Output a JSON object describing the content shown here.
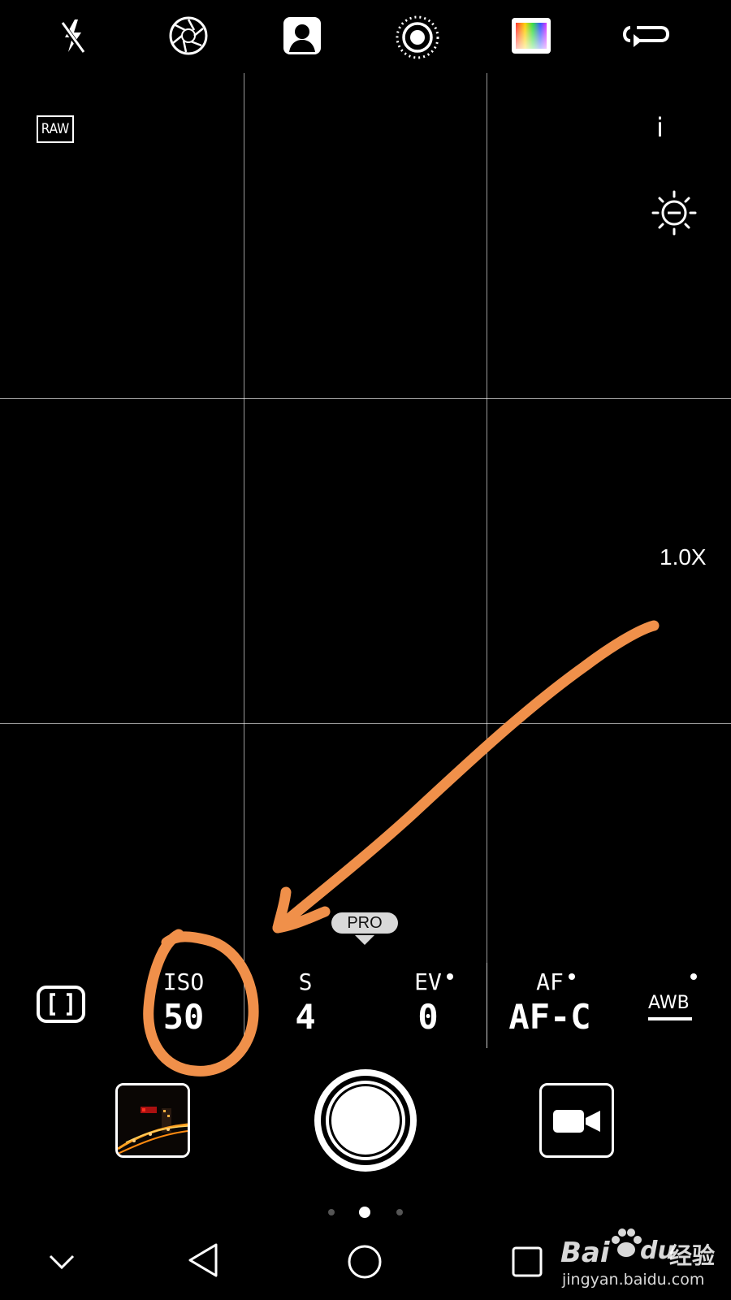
{
  "top_bar": {
    "icons": [
      "flash-off-icon",
      "aperture-icon",
      "portrait-icon",
      "live-photo-icon",
      "color-filter-icon",
      "switch-camera-icon"
    ]
  },
  "viewfinder": {
    "raw_label": "RAW",
    "info_label": "i",
    "exposure_icon": "brightness-minus-icon",
    "zoom_label": "1.0X"
  },
  "mode_indicator": {
    "label": "PRO"
  },
  "pro_params": [
    {
      "label": "ISO",
      "value": "50"
    },
    {
      "label": "S",
      "value": "4"
    },
    {
      "label": "EV",
      "value": "0"
    },
    {
      "label": "AF",
      "value": "AF-C"
    }
  ],
  "awb_label": "AWB",
  "metering_icon": "metering-mode-icon",
  "page_indicator": {
    "count": 3,
    "active_index": 1
  },
  "annotation": {
    "color": "#F0904A"
  },
  "watermark": {
    "brand": "Bai",
    "brand2": "du",
    "cn": "经验",
    "url": "jingyan.baidu.com"
  }
}
